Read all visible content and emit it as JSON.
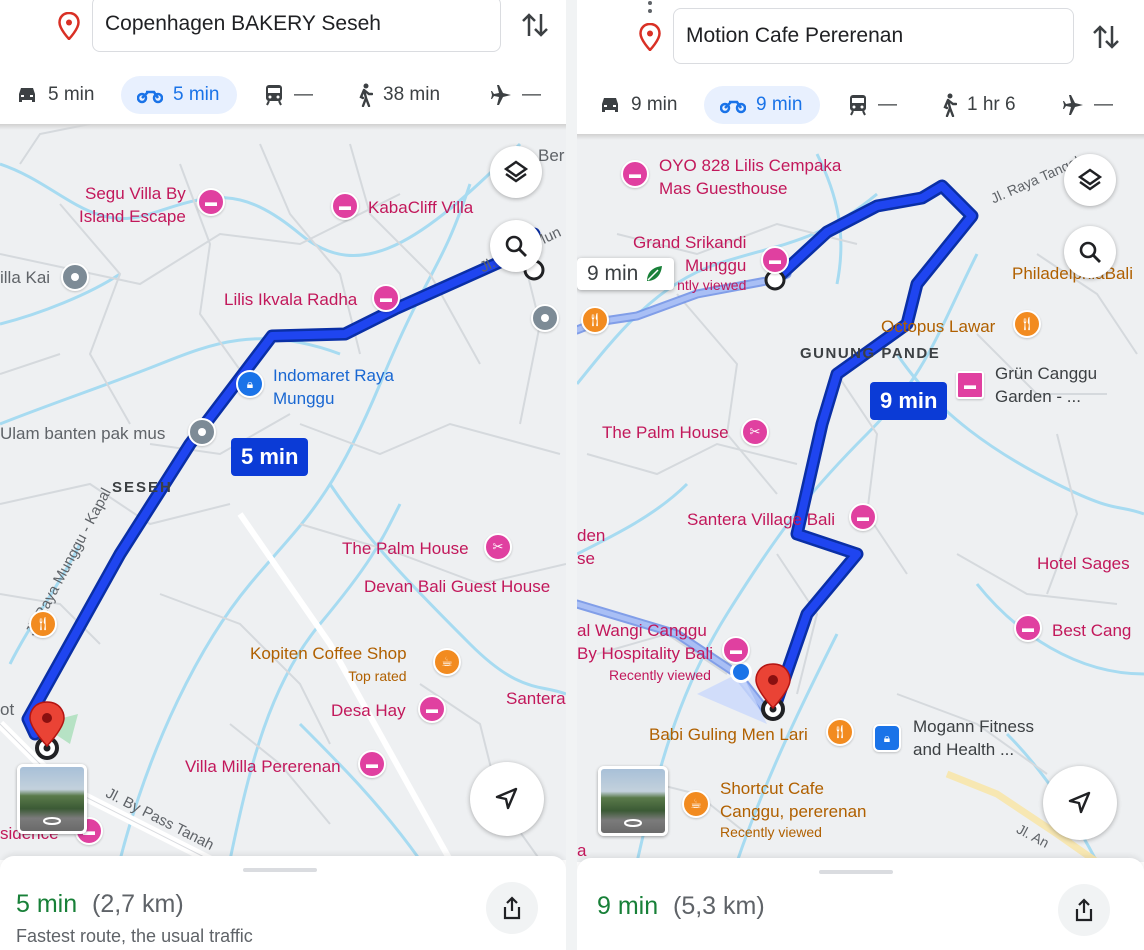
{
  "left": {
    "destination": "Copenhagen BAKERY Seseh",
    "modes": {
      "car": "5 min",
      "motorbike": "5 min",
      "transit": "—",
      "walk": "38 min",
      "flight": "—"
    },
    "route_badge": "5 min",
    "area_label": "SESEH",
    "road_labels": {
      "main": "Jl. Raya Munggu - Kapal",
      "bypass": "Jl. By Pass Tanah",
      "top": "Jl. Raya Mun"
    },
    "places": {
      "segu_1": "Segu Villa By",
      "segu_2": "Island Escape",
      "kabacliff": "KabaCliff Villa",
      "ber": "Ber",
      "illa_kai": "illa Kai",
      "lilis": "Lilis Ikvala Radha",
      "indomaret_1": "Indomaret Raya",
      "indomaret_2": "Munggu",
      "ulam": "Ulam banten pak mus",
      "palm": "The Palm House",
      "devan": "Devan Bali Guest House",
      "kopiten": "Kopiten Coffee Shop",
      "kopiten_sub": "Top rated",
      "santera": "Santera",
      "desa": "Desa Hay",
      "villa_milla": "Villa Milla Pererenan",
      "ot": "ot",
      "sidence": "sidence"
    },
    "summary": {
      "time": "5 min",
      "distance": "(2,7 km)",
      "note": "Fastest route, the usual traffic"
    }
  },
  "right": {
    "destination": "Motion Cafe Pererenan",
    "modes": {
      "car": "9 min",
      "motorbike": "9 min",
      "transit": "—",
      "walk": "1 hr 6",
      "flight": "—"
    },
    "route_badge": "9 min",
    "alt_badge": "9 min",
    "area_label": "GUNUNG PANDE",
    "road_labels": {
      "top": "Jl. Raya Tangeb"
    },
    "places": {
      "oyo_1": "OYO 828 Lilis Cempaka",
      "oyo_2": "Mas Guesthouse",
      "grand_1": "Grand Srikandi",
      "grand_2": "Munggu",
      "grand_sub": "ntly viewed",
      "philadel": "PhiladelphiaBali",
      "octopus": "Octopus Lawar",
      "grun_1": "Grün Canggu",
      "grun_2": "Garden - ...",
      "palm": "The Palm House",
      "santera": "Santera Village Bali",
      "den_1": "den",
      "den_2": "se",
      "hotel_sages": "Hotel Sages",
      "best_cang": "Best Cang",
      "wangi_1": "al Wangi Canggu",
      "wangi_2": "By Hospitality Bali",
      "wangi_sub": "Recently viewed",
      "babi": "Babi Guling Men Lari",
      "mogann_1": "Mogann Fitness",
      "mogann_2": "and Health ...",
      "shortcut_1": "Shortcut Cafe",
      "shortcut_2": "Canggu, pererenan",
      "shortcut_sub": "Recently viewed",
      "a": "a",
      "jlan": "Jl. An"
    },
    "summary": {
      "time": "9 min",
      "distance": "(5,3 km)"
    }
  },
  "colors": {
    "route": "#0b3bd6",
    "active_mode_bg": "#e8f0fe",
    "accent": "#1a73e8",
    "time_green": "#188038",
    "hotel_pink": "#e040a0",
    "food_orange": "#f28b20"
  },
  "icons": [
    "location-pin-icon",
    "swap-icon",
    "car-icon",
    "motorbike-icon",
    "transit-icon",
    "walk-icon",
    "flight-icon",
    "layers-icon",
    "search-icon",
    "navigation-icon",
    "share-icon",
    "hotel-icon",
    "food-icon",
    "cafe-icon",
    "shopping-icon",
    "leaf-icon"
  ]
}
